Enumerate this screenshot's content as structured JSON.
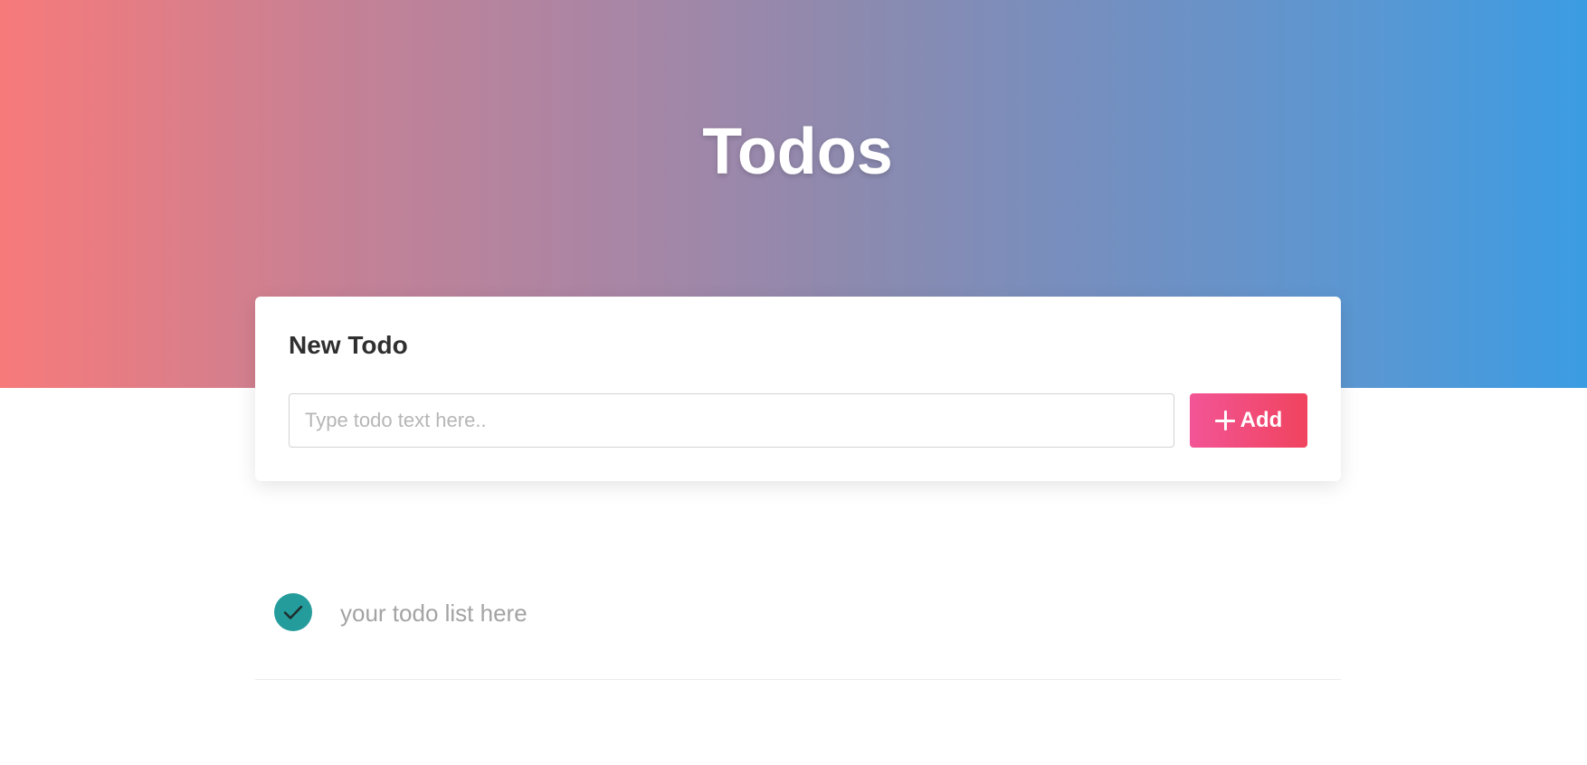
{
  "header": {
    "title": "Todos"
  },
  "new_todo": {
    "title": "New Todo",
    "input_placeholder": "Type todo text here..",
    "input_value": "",
    "add_label": "Add",
    "add_icon": "plus-icon"
  },
  "todos": [
    {
      "text": "your todo list here",
      "completed": true,
      "icon": "check-icon"
    }
  ],
  "colors": {
    "gradient_left": "#f77a7a",
    "gradient_right": "#3b9ce3",
    "add_button_left": "#f25596",
    "add_button_right": "#f0435e",
    "check_circle": "#249c9c",
    "todo_text": "#a3a3a3"
  }
}
